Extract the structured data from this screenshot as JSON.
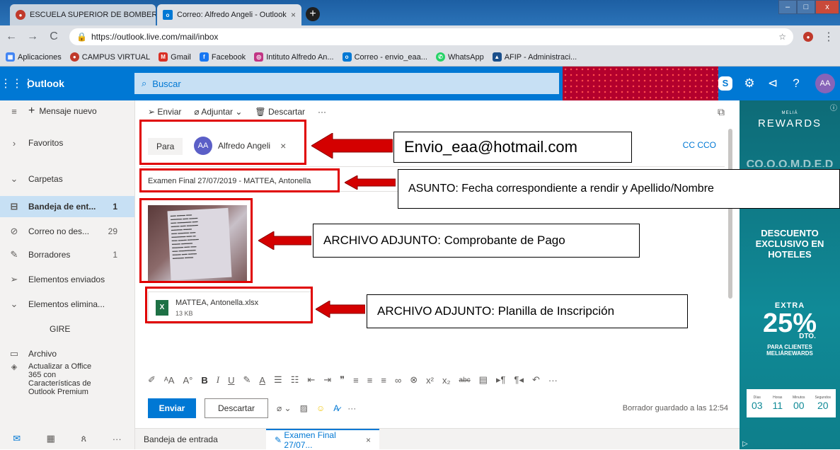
{
  "browser": {
    "tabs": [
      {
        "label": "ESCUELA SUPERIOR DE BOMBER"
      },
      {
        "label": "Correo: Alfredo Angeli - Outlook"
      }
    ],
    "url": "https://outlook.live.com/mail/inbox",
    "bookmarks": [
      "Aplicaciones",
      "CAMPUS VIRTUAL",
      "Gmail",
      "Facebook",
      "Intituto Alfredo An...",
      "Correo - envio_eaa...",
      "WhatsApp",
      "AFIP - Administraci..."
    ]
  },
  "outlook": {
    "brand": "Outlook",
    "search_placeholder": "Buscar",
    "avatar_initials": "AA"
  },
  "leftnav": {
    "new_message": "Mensaje nuevo",
    "items": [
      {
        "label": "Favoritos",
        "count": ""
      },
      {
        "label": "Carpetas",
        "count": ""
      },
      {
        "label": "Bandeja de ent...",
        "count": "1"
      },
      {
        "label": "Correo no des...",
        "count": "29"
      },
      {
        "label": "Borradores",
        "count": "1"
      },
      {
        "label": "Elementos enviados",
        "count": ""
      },
      {
        "label": "Elementos elimina...",
        "count": ""
      },
      {
        "label": "GIRE",
        "count": ""
      },
      {
        "label": "Archivo",
        "count": ""
      }
    ],
    "upgrade": "Actualizar a Office 365 con Características de Outlook Premium"
  },
  "compose": {
    "cmd_send": "Enviar",
    "cmd_attach": "Adjuntar",
    "cmd_discard": "Descartar",
    "to_label": "Para",
    "recipient_initials": "AA",
    "recipient_name": "Alfredo Angeli",
    "cc_bcc": "CC  CCO",
    "subject": "Examen Final 27/07/2019 - MATTEA, Antonella",
    "attachment_name": "MATTEA, Antonella.xlsx",
    "attachment_size": "13 KB",
    "send_button": "Enviar",
    "discard_button": "Descartar",
    "saved_status": "Borrador guardado a las 12:54",
    "bottom_tab_inbox": "Bandeja de entrada",
    "bottom_tab_draft": "Examen Final 27/07..."
  },
  "ad": {
    "brand_small": "MELIÁ",
    "brand": "REWARDS",
    "partial_text": "CO.O.O.M.D.E.D",
    "headline": "DESCUENTO EXCLUSIVO EN HOTELES",
    "extra": "EXTRA",
    "percent": "25%",
    "dto": "DTO.",
    "for_clients": "PARA CLIENTES MELIÁREWARDS",
    "timer": [
      {
        "label": "Días",
        "value": "03"
      },
      {
        "label": "Horas",
        "value": "11"
      },
      {
        "label": "Minutos",
        "value": "00"
      },
      {
        "label": "Segundos",
        "value": "20"
      }
    ]
  },
  "annotations": {
    "email": "Envio_eaa@hotmail.com",
    "subject_note": "ASUNTO: Fecha correspondiente a rendir y Apellido/Nombre",
    "receipt_note": "ARCHIVO ADJUNTO: Comprobante de Pago",
    "form_note": "ARCHIVO ADJUNTO: Planilla de Inscripción"
  },
  "colors": {
    "outlook_blue": "#0078d4",
    "annotation_red": "#e00000",
    "ad_teal": "#108a97"
  }
}
